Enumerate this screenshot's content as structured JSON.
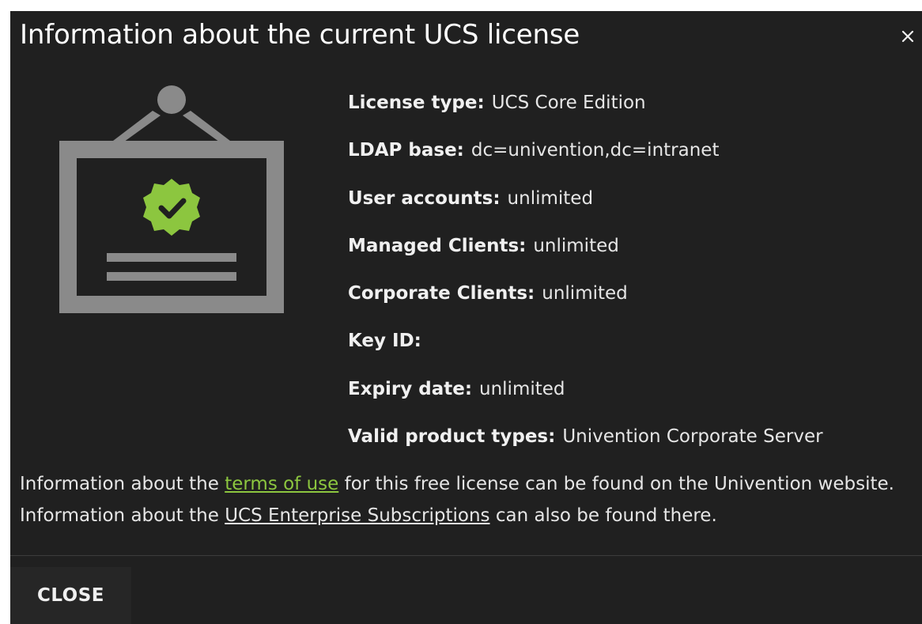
{
  "dialog": {
    "title": "Information about the current UCS license",
    "close_icon": "close-icon"
  },
  "license_fields": [
    {
      "label": "License type:",
      "value": "UCS Core Edition"
    },
    {
      "label": "LDAP base:",
      "value": "dc=univention,dc=intranet"
    },
    {
      "label": "User accounts:",
      "value": "unlimited"
    },
    {
      "label": "Managed Clients:",
      "value": "unlimited"
    },
    {
      "label": "Corporate Clients:",
      "value": "unlimited"
    },
    {
      "label": "Key ID:",
      "value": ""
    },
    {
      "label": "Expiry date:",
      "value": "unlimited"
    },
    {
      "label": "Valid product types:",
      "value": "Univention Corporate Server"
    }
  ],
  "footnote": {
    "part1": "Information about the ",
    "terms_link": "terms of use",
    "part2": " for this free license can be found on the Univention website. Information about the ",
    "subscriptions_link": "UCS Enterprise Subscriptions",
    "part3": " can also be found there."
  },
  "buttons": {
    "close_label": "CLOSE"
  },
  "colors": {
    "background": "#202020",
    "accent_green": "#8cc63f",
    "icon_gray": "#8a8a8a"
  },
  "icons": {
    "certificate": "certificate-icon",
    "badge": "check-badge-icon"
  }
}
